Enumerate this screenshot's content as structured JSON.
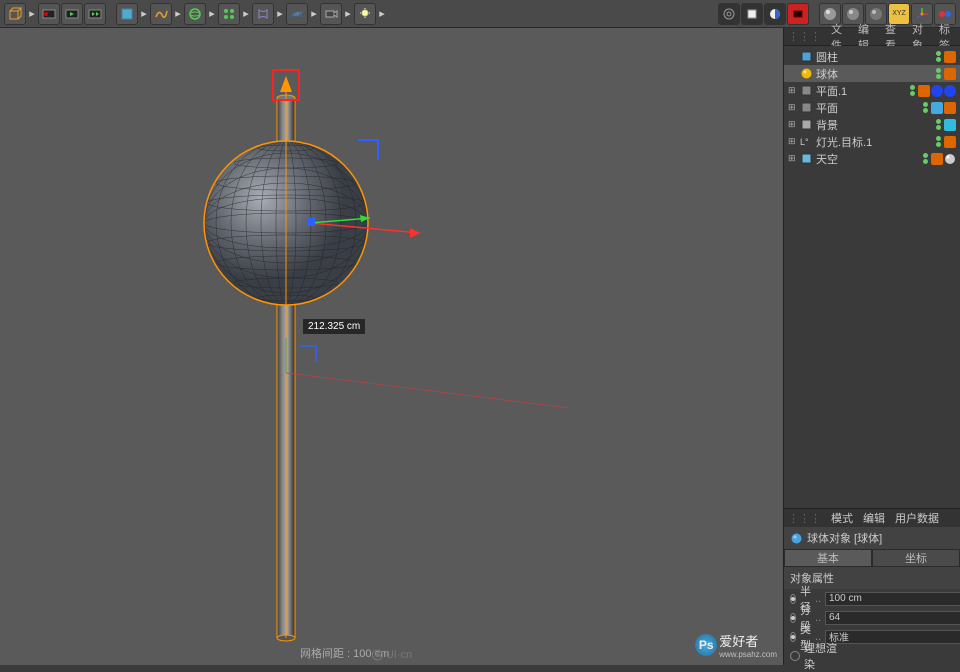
{
  "toolbar": {
    "groups": [
      [
        "cube-icon",
        "record-icon",
        "play-icon",
        "play-range-icon"
      ],
      [
        "primitive-icon",
        "spline-icon",
        "nurbs-icon",
        "array-icon",
        "deformer-icon",
        "floor-icon",
        "camera-icon",
        "light-icon"
      ],
      [
        "render-view-icon",
        "render-region-icon",
        "render-active-icon",
        "render-settings-icon"
      ],
      [
        "mat1-icon",
        "mat2-icon",
        "mat3-icon",
        "xyz-icon",
        "axis-icon",
        "snap-icon"
      ]
    ]
  },
  "panel_tabs": {
    "file": "文件",
    "edit": "编辑",
    "view": "查看",
    "object": "对象",
    "tags": "标签"
  },
  "tree": [
    {
      "icon": "#4aa3df",
      "label": "圆柱",
      "sel": false,
      "dots": [
        "#6c6",
        "#6c6"
      ],
      "tags": [
        "#d60"
      ]
    },
    {
      "icon": "#f5b800",
      "label": "球体",
      "sel": true,
      "shape": "sphere",
      "dots": [
        "#6c6",
        "#6c6"
      ],
      "tags": [
        "#d60"
      ]
    },
    {
      "icon": "#888",
      "label": "平面.1",
      "sel": false,
      "dots": [
        "#6c6",
        "#6c6"
      ],
      "tags": [
        "#d60",
        "#24e",
        "#24e"
      ]
    },
    {
      "icon": "#888",
      "label": "平面",
      "sel": false,
      "dots": [
        "#6c6",
        "#6c6"
      ],
      "tags": [
        "#4ad",
        "#d60"
      ]
    },
    {
      "icon": "#aaa",
      "label": "背景",
      "sel": false,
      "dots": [
        "#6c6",
        "#6c6"
      ],
      "tags": [
        "#3bd"
      ]
    },
    {
      "icon": "#ccc",
      "label": "灯光.目标.1",
      "sel": false,
      "prefix": "L°",
      "dots": [
        "#6c6",
        "#6c6"
      ],
      "tags": [
        "#d60"
      ]
    },
    {
      "icon": "#6bd",
      "label": "天空",
      "sel": false,
      "dots": [
        "#6c6",
        "#6c6"
      ],
      "tags": [
        "#d60",
        "#ccc"
      ]
    }
  ],
  "attr": {
    "mode": "模式",
    "edit": "编辑",
    "userdata": "用户数据",
    "title": "球体对象 [球体]",
    "tab_basic": "基本",
    "tab_coord": "坐标",
    "section": "对象属性",
    "rows": [
      {
        "label": "半径",
        "value": "100 cm",
        "spinner": true
      },
      {
        "label": "分段",
        "value": "64",
        "spinner": true
      },
      {
        "label": "类型",
        "value": "标准",
        "spinner": false
      },
      {
        "label": "理想渲染",
        "value": "",
        "spinner": false,
        "novalue": true
      }
    ]
  },
  "viewport": {
    "measure": "212.325 cm",
    "status": "网格间距 : 100 cm",
    "wm": "UI·cn",
    "ps": "爱好者",
    "ps_url": "www.psahz.com"
  },
  "colors": {
    "axis_x": "#ff3030",
    "axis_y": "#30ff30",
    "axis_z": "#3060ff",
    "select": "#ff9500"
  }
}
